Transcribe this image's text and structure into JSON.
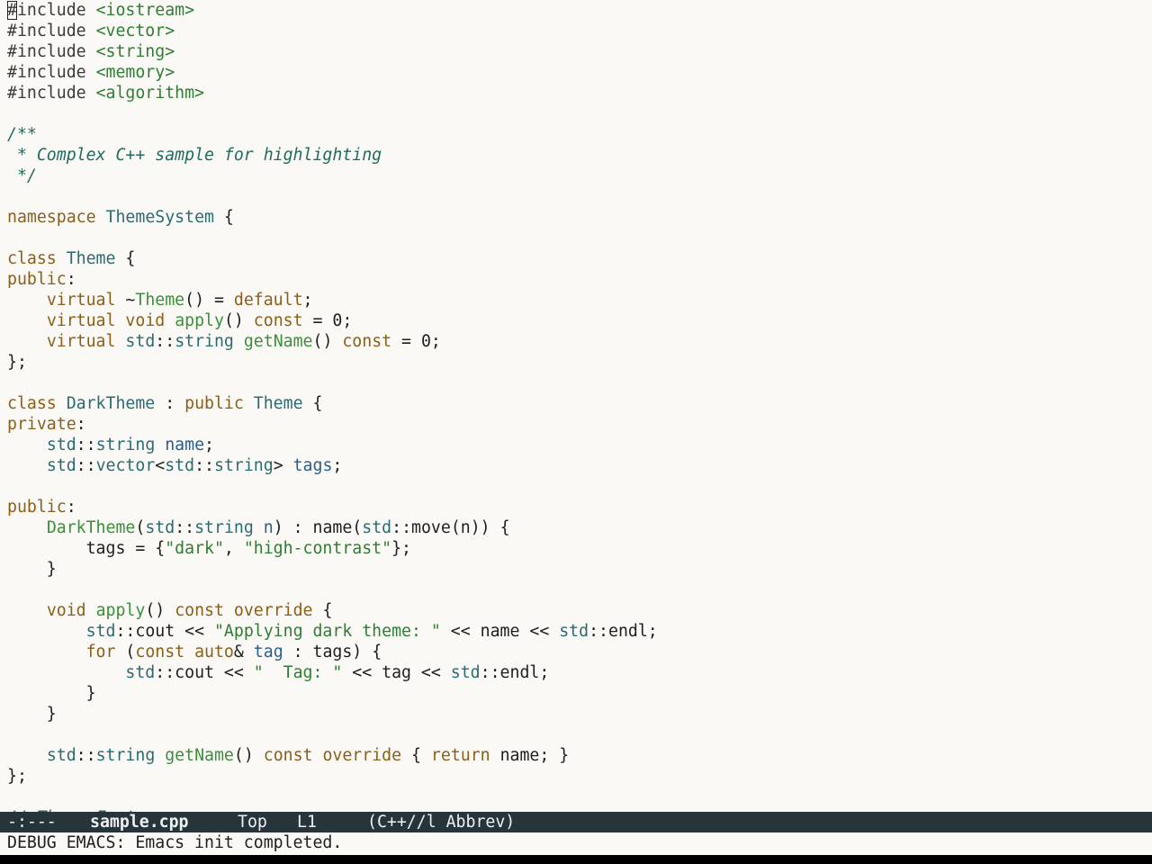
{
  "editor": {
    "buffer_lines": [
      [
        [
          "pp",
          "#"
        ],
        [
          "pp",
          "include "
        ],
        [
          "str",
          "<iostream>"
        ]
      ],
      [
        [
          "pp",
          "#include "
        ],
        [
          "str",
          "<vector>"
        ]
      ],
      [
        [
          "pp",
          "#include "
        ],
        [
          "str",
          "<string>"
        ]
      ],
      [
        [
          "pp",
          "#include "
        ],
        [
          "str",
          "<memory>"
        ]
      ],
      [
        [
          "pp",
          "#include "
        ],
        [
          "str",
          "<algorithm>"
        ]
      ],
      [],
      [
        [
          "cm",
          "/**"
        ]
      ],
      [
        [
          "cm",
          " * Complex C++ sample for highlighting"
        ]
      ],
      [
        [
          "cm",
          " */"
        ]
      ],
      [],
      [
        [
          "kw",
          "namespace"
        ],
        [
          "pl",
          " "
        ],
        [
          "ty",
          "ThemeSystem"
        ],
        [
          "pl",
          " {"
        ]
      ],
      [],
      [
        [
          "kw",
          "class"
        ],
        [
          "pl",
          " "
        ],
        [
          "ty",
          "Theme"
        ],
        [
          "pl",
          " {"
        ]
      ],
      [
        [
          "kw",
          "public"
        ],
        [
          "pl",
          ":"
        ]
      ],
      [
        [
          "pl",
          "    "
        ],
        [
          "kw",
          "virtual"
        ],
        [
          "pl",
          " ~"
        ],
        [
          "fn",
          "Theme"
        ],
        [
          "pl",
          "() = "
        ],
        [
          "kw",
          "default"
        ],
        [
          "pl",
          ";"
        ]
      ],
      [
        [
          "pl",
          "    "
        ],
        [
          "kw",
          "virtual"
        ],
        [
          "pl",
          " "
        ],
        [
          "kw",
          "void"
        ],
        [
          "pl",
          " "
        ],
        [
          "fn",
          "apply"
        ],
        [
          "pl",
          "() "
        ],
        [
          "kw",
          "const"
        ],
        [
          "pl",
          " = 0;"
        ]
      ],
      [
        [
          "pl",
          "    "
        ],
        [
          "kw",
          "virtual"
        ],
        [
          "pl",
          " "
        ],
        [
          "ty",
          "std"
        ],
        [
          "pl",
          "::"
        ],
        [
          "ty",
          "string"
        ],
        [
          "pl",
          " "
        ],
        [
          "fn",
          "getName"
        ],
        [
          "pl",
          "() "
        ],
        [
          "kw",
          "const"
        ],
        [
          "pl",
          " = 0;"
        ]
      ],
      [
        [
          "pl",
          "};"
        ]
      ],
      [],
      [
        [
          "kw",
          "class"
        ],
        [
          "pl",
          " "
        ],
        [
          "ty",
          "DarkTheme"
        ],
        [
          "pl",
          " : "
        ],
        [
          "kw",
          "public"
        ],
        [
          "pl",
          " "
        ],
        [
          "ty",
          "Theme"
        ],
        [
          "pl",
          " {"
        ]
      ],
      [
        [
          "kw",
          "private"
        ],
        [
          "pl",
          ":"
        ]
      ],
      [
        [
          "pl",
          "    "
        ],
        [
          "ty",
          "std"
        ],
        [
          "pl",
          "::"
        ],
        [
          "ty",
          "string"
        ],
        [
          "pl",
          " "
        ],
        [
          "var",
          "name"
        ],
        [
          "pl",
          ";"
        ]
      ],
      [
        [
          "pl",
          "    "
        ],
        [
          "ty",
          "std"
        ],
        [
          "pl",
          "::"
        ],
        [
          "ty",
          "vector"
        ],
        [
          "pl",
          "<"
        ],
        [
          "ty",
          "std"
        ],
        [
          "pl",
          "::"
        ],
        [
          "ty",
          "string"
        ],
        [
          "pl",
          "> "
        ],
        [
          "var",
          "tags"
        ],
        [
          "pl",
          ";"
        ]
      ],
      [],
      [
        [
          "kw",
          "public"
        ],
        [
          "pl",
          ":"
        ]
      ],
      [
        [
          "pl",
          "    "
        ],
        [
          "fn",
          "DarkTheme"
        ],
        [
          "pl",
          "("
        ],
        [
          "ty",
          "std"
        ],
        [
          "pl",
          "::"
        ],
        [
          "ty",
          "string"
        ],
        [
          "pl",
          " "
        ],
        [
          "var",
          "n"
        ],
        [
          "pl",
          ") : name("
        ],
        [
          "ty",
          "std"
        ],
        [
          "pl",
          "::move(n)) {"
        ]
      ],
      [
        [
          "pl",
          "        tags = {"
        ],
        [
          "str",
          "\"dark\""
        ],
        [
          "pl",
          ", "
        ],
        [
          "str",
          "\"high-contrast\""
        ],
        [
          "pl",
          "};"
        ]
      ],
      [
        [
          "pl",
          "    }"
        ]
      ],
      [],
      [
        [
          "pl",
          "    "
        ],
        [
          "kw",
          "void"
        ],
        [
          "pl",
          " "
        ],
        [
          "fn",
          "apply"
        ],
        [
          "pl",
          "() "
        ],
        [
          "kw",
          "const"
        ],
        [
          "pl",
          " "
        ],
        [
          "kw",
          "override"
        ],
        [
          "pl",
          " {"
        ]
      ],
      [
        [
          "pl",
          "        "
        ],
        [
          "ty",
          "std"
        ],
        [
          "pl",
          "::cout << "
        ],
        [
          "str",
          "\"Applying dark theme: \""
        ],
        [
          "pl",
          " << name << "
        ],
        [
          "ty",
          "std"
        ],
        [
          "pl",
          "::endl;"
        ]
      ],
      [
        [
          "pl",
          "        "
        ],
        [
          "kw",
          "for"
        ],
        [
          "pl",
          " ("
        ],
        [
          "kw",
          "const"
        ],
        [
          "pl",
          " "
        ],
        [
          "kw",
          "auto"
        ],
        [
          "pl",
          "& "
        ],
        [
          "var",
          "tag"
        ],
        [
          "pl",
          " : tags) {"
        ]
      ],
      [
        [
          "pl",
          "            "
        ],
        [
          "ty",
          "std"
        ],
        [
          "pl",
          "::cout << "
        ],
        [
          "str",
          "\"  Tag: \""
        ],
        [
          "pl",
          " << tag << "
        ],
        [
          "ty",
          "std"
        ],
        [
          "pl",
          "::endl;"
        ]
      ],
      [
        [
          "pl",
          "        }"
        ]
      ],
      [
        [
          "pl",
          "    }"
        ]
      ],
      [],
      [
        [
          "pl",
          "    "
        ],
        [
          "ty",
          "std"
        ],
        [
          "pl",
          "::"
        ],
        [
          "ty",
          "string"
        ],
        [
          "pl",
          " "
        ],
        [
          "fn",
          "getName"
        ],
        [
          "pl",
          "() "
        ],
        [
          "kw",
          "const"
        ],
        [
          "pl",
          " "
        ],
        [
          "kw",
          "override"
        ],
        [
          "pl",
          " { "
        ],
        [
          "kw",
          "return"
        ],
        [
          "pl",
          " name; }"
        ]
      ],
      [
        [
          "pl",
          "};"
        ]
      ],
      [],
      [
        [
          "cm",
          "// Theme Factory"
        ]
      ]
    ]
  },
  "mode_line": {
    "status": "-:---",
    "buffer_name": "sample.cpp",
    "position": "Top",
    "line": "L1",
    "mode": "(C++//l Abbrev)"
  },
  "echo_area": {
    "message": "DEBUG EMACS: Emacs init completed."
  },
  "colors": {
    "background": "#fbf9f5",
    "keyword": "#8b5e1a",
    "string": "#2e7d32",
    "type": "#2a6b73",
    "function": "#3b8f3b",
    "variable": "#2b5d8a",
    "comment": "#1f6b5e",
    "mode_line_bg": "#27353b",
    "mode_line_fg": "#eef1f2"
  }
}
